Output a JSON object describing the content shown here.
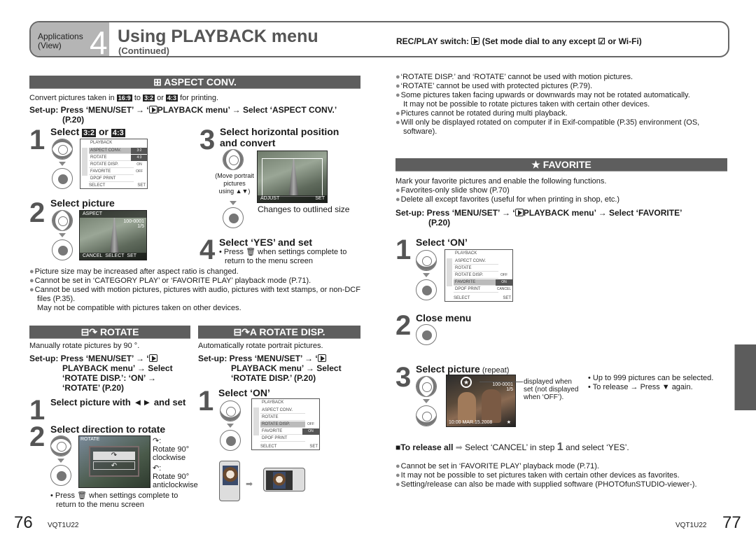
{
  "header": {
    "category": "Applications",
    "category_sub": "(View)",
    "chapter_num": "4",
    "title": "Using PLAYBACK menu",
    "subtitle": "(Continued)",
    "mode_prefix": "REC/PLAY switch:",
    "mode_text": "(Set mode dial to any except",
    "mode_or": "or",
    "mode_wifi": "Wi-Fi",
    "mode_close": ")"
  },
  "aspect": {
    "heading_icon": "aspect-conv-icon",
    "heading": "ASPECT CONV.",
    "intro_a": "Convert pictures taken in",
    "tag_169": "16:9",
    "intro_to": "to",
    "tag_32": "3:2",
    "intro_or": "or",
    "tag_43": "4:3",
    "intro_b": "for printing.",
    "setup_a": "Set-up: Press ‘MENU/SET’ → ‘",
    "setup_b": "PLAYBACK menu’ → Select ‘ASPECT CONV.’",
    "setup_page": "(P.20)",
    "step1_num": "1",
    "step1_title": "Select",
    "step1_or": "or",
    "step2_num": "2",
    "step2_title": "Select picture",
    "step3_num": "3",
    "step3_title_a": "Select horizontal position",
    "step3_title_b": "and convert",
    "step3_note_a": "(Move portrait",
    "step3_note_b": "pictures",
    "step3_note_c": "using ▲▼)",
    "step3_caption": "Changes to outlined size",
    "step4_num": "4",
    "step4_title": "Select ‘YES’ and set",
    "step4_note_a": "• Press",
    "step4_note_b": "when settings complete to",
    "step4_note_c": "return to the menu screen",
    "bullets": [
      "Picture size may be increased after aspect ratio is changed.",
      "Cannot be set in ‘CATEGORY PLAY’ or ‘FAVORITE PLAY’ playback mode (P.71).",
      "Cannot be used with motion pictures, pictures with audio, pictures with text stamps, or non-DCF files (P.35)."
    ],
    "note": "May not be compatible with pictures taken on other devices."
  },
  "menu_screen": {
    "header": "PLAYBACK",
    "items": [
      "ASPECT CONV.",
      "ROTATE",
      "ROTATE DISP.",
      "FAVORITE",
      "DPOF PRINT"
    ],
    "aspect_values": [
      "ON",
      "OFF"
    ],
    "aspect_opts": [
      "3:2",
      "4:3"
    ],
    "select_label": "SELECT",
    "set_label": "SET",
    "rotate_opts": [
      "OFF",
      "ON"
    ],
    "favorite_opts": [
      "OFF",
      "ON",
      "CANCEL"
    ]
  },
  "photo_screens": {
    "aspect_top": "ASPECT",
    "aspect_file": "100-0001",
    "aspect_count": "1/5",
    "aspect_bottom_cancel": "CANCEL",
    "aspect_bottom_select": "SELECT",
    "aspect_bottom_set": "SET",
    "adjust_label": "ADJUST",
    "rotate_top": "ROTATE",
    "favorite_file": "100-0001",
    "favorite_count": "1/5",
    "favorite_date": "10:00 MAR.15.2008"
  },
  "rotate": {
    "heading": "ROTATE",
    "intro": "Manually rotate pictures by 90 °.",
    "setup_lines": [
      "Set-up: Press ‘MENU/SET’ → ‘",
      "PLAYBACK menu’ → Select",
      "‘ROTATE DISP.’: ‘ON’ →",
      "‘ROTATE’ (P.20)"
    ],
    "step1_num": "1",
    "step1_title": "Select picture with ◄► and set",
    "step2_num": "2",
    "step2_title": "Select direction to rotate",
    "cw_label_a": "Rotate 90°",
    "cw_label_b": "clockwise",
    "ccw_label_a": "Rotate 90°",
    "ccw_label_b": "anticlockwise",
    "note_a": "• Press",
    "note_b": "when settings complete to",
    "note_c": "return to the menu screen"
  },
  "rotate_disp": {
    "heading": "ROTATE DISP.",
    "intro": "Automatically rotate portrait pictures.",
    "setup_lines": [
      "Set-up: Press ‘MENU/SET’ → ‘",
      "PLAYBACK menu’ → Select",
      "‘ROTATE DISP.’ (P.20)"
    ],
    "step1_num": "1",
    "step1_title": "Select ‘ON’"
  },
  "right_notes": [
    "‘ROTATE DISP.’ and ‘ROTATE’ cannot be used with motion pictures.",
    "‘ROTATE’ cannot be used with protected pictures (P.79).",
    "Some pictures taken facing upwards or downwards may not be rotated automatically.",
    "Pictures cannot be rotated during multi playback.",
    "Will only be displayed rotated on computer if in Exif-compatible (P.35) environment (OS,"
  ],
  "right_notes_cont": {
    "n2": "It may not be possible to rotate pictures taken with certain other devices.",
    "n4": "software)."
  },
  "favorite": {
    "heading": "FAVORITE",
    "intro": "Mark your favorite pictures and enable the following functions.",
    "bullets": [
      "Favorites-only slide show (P.70)",
      "Delete all except favorites (useful for when printing in shop, etc.)"
    ],
    "setup_a": "Set-up: Press ‘MENU/SET’ → ‘",
    "setup_b": "PLAYBACK menu’ → Select ‘FAVORITE’",
    "setup_page": "(P.20)",
    "step1_num": "1",
    "step1_title": "Select ‘ON’",
    "step2_num": "2",
    "step2_title": "Close menu",
    "step3_num": "3",
    "step3_title": "Select picture",
    "step3_repeat": "(repeat)",
    "callout_a": "displayed when",
    "callout_b": "set (not displayed",
    "callout_c": "when ‘OFF’).",
    "tips": [
      "• Up to 999 pictures can be selected.",
      "• To release → Press ▼ again."
    ],
    "release_label": "■To release all",
    "release_text_a": "Select ‘CANCEL’ in step",
    "release_step": "1",
    "release_text_b": "and select ‘YES’.",
    "bottom_bullets": [
      "Cannot be set in ‘FAVORITE PLAY’ playback mode (P.71).",
      "It may not be possible to set pictures taken with certain other devices as favorites.",
      "Setting/release can also be made with supplied software (PHOTOfunSTUDIO-viewer-)."
    ]
  },
  "footer": {
    "left_page": "76",
    "left_code": "VQT1U22",
    "right_code": "VQT1U22",
    "right_page": "77"
  },
  "colors": {
    "section_bar": "#5e5e5e",
    "header_gray": "#b5b5b5",
    "bullet": "#888888"
  }
}
